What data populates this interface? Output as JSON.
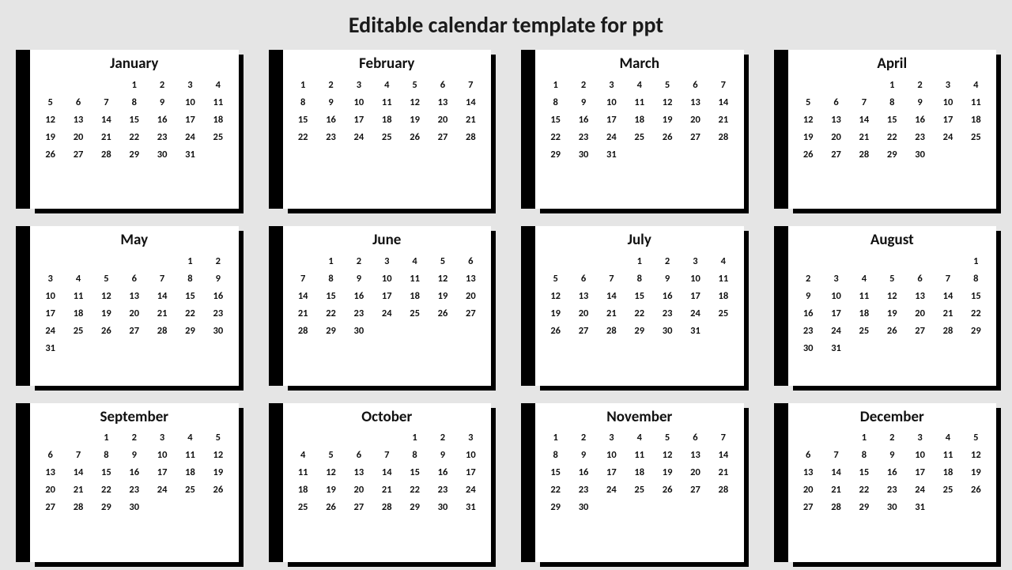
{
  "title": "Editable calendar template for ppt",
  "months": [
    {
      "name": "January",
      "start": 3,
      "days": 31
    },
    {
      "name": "February",
      "start": 0,
      "days": 28
    },
    {
      "name": "March",
      "start": 0,
      "days": 31
    },
    {
      "name": "April",
      "start": 3,
      "days": 30
    },
    {
      "name": "May",
      "start": 5,
      "days": 31
    },
    {
      "name": "June",
      "start": 1,
      "days": 30
    },
    {
      "name": "July",
      "start": 3,
      "days": 31
    },
    {
      "name": "August",
      "start": 6,
      "days": 31
    },
    {
      "name": "September",
      "start": 2,
      "days": 30
    },
    {
      "name": "October",
      "start": 4,
      "days": 31
    },
    {
      "name": "November",
      "start": 0,
      "days": 30
    },
    {
      "name": "December",
      "start": 2,
      "days": 31
    }
  ]
}
